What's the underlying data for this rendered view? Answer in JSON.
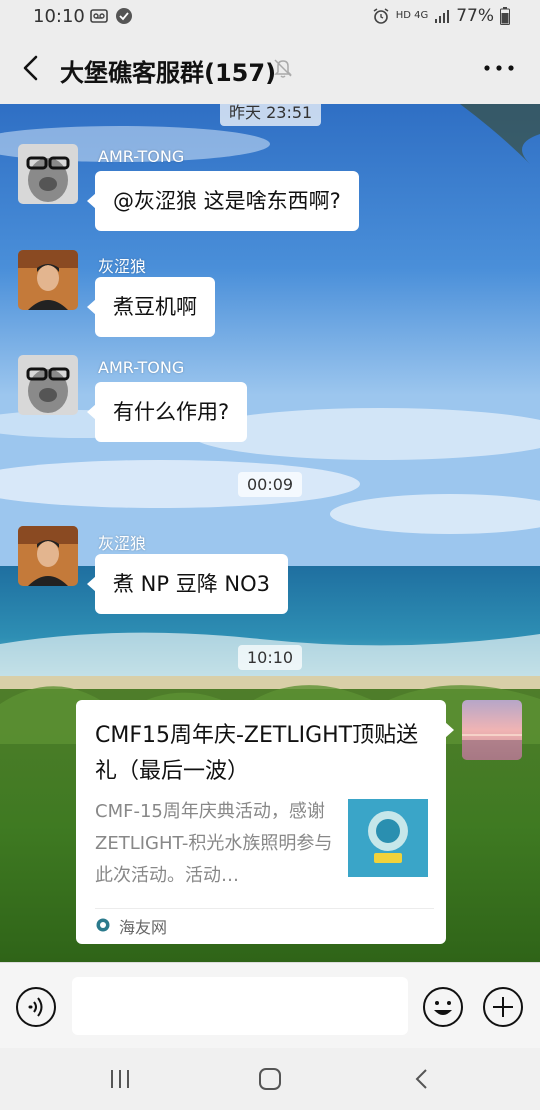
{
  "status_bar": {
    "time": "10:10",
    "network": "HD 4G",
    "battery": "77%"
  },
  "header": {
    "title": "大堡礁客服群(157)"
  },
  "chat": {
    "top_timestamp": "昨天 23:51",
    "messages": [
      {
        "sender": "AMR-TONG",
        "text": "@灰涩狼  这是啥东西啊?"
      },
      {
        "sender": "灰涩狼",
        "text": "煮豆机啊"
      },
      {
        "sender": "AMR-TONG",
        "text": "有什么作用?"
      },
      {
        "timestamp": "00:09"
      },
      {
        "sender": "灰涩狼",
        "text": "煮 NP 豆降 NO3"
      },
      {
        "timestamp": "10:10"
      }
    ],
    "link_card": {
      "title": "CMF15周年庆-ZETLIGHT顶贴送礼（最后一波）",
      "description": "CMF-15周年庆典活动，感谢ZETLIGHT-积光水族照明参与此次活动。活动…",
      "source": "海友网"
    }
  },
  "input_bar": {
    "placeholder": ""
  }
}
